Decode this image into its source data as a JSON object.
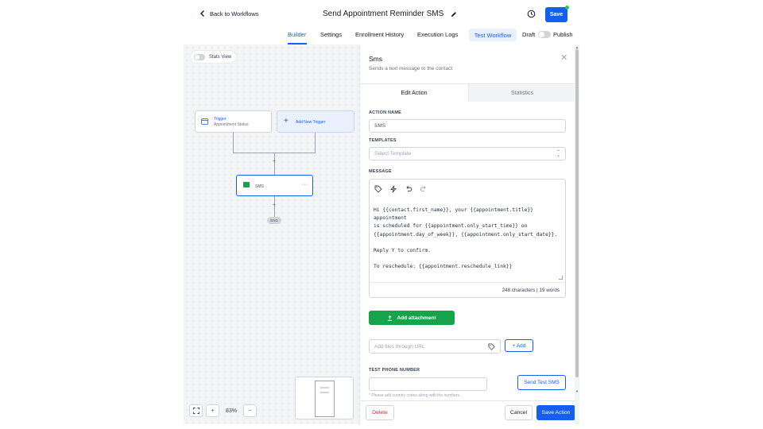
{
  "header": {
    "back_label": "Back to Workflows",
    "title": "Send Appointment Reminder SMS",
    "save_label": "Save"
  },
  "tabs": {
    "items": [
      {
        "label": "Builder",
        "active": true
      },
      {
        "label": "Settings"
      },
      {
        "label": "Enrollment History"
      },
      {
        "label": "Execution Logs"
      }
    ],
    "test_workflow": "Test Workflow",
    "draft": "Draft",
    "publish": "Publish"
  },
  "canvas": {
    "stats_view": "Stats View",
    "trigger_title": "Trigger",
    "trigger_sub": "Appointment Status",
    "add_trigger": "Add New Trigger",
    "sms_node": "SMS",
    "end": "END",
    "zoom": "83%"
  },
  "panel": {
    "title": "Sms",
    "subtitle": "Sends a text message to the contact",
    "tab_edit": "Edit Action",
    "tab_stats": "Statistics",
    "action_name_label": "ACTION NAME",
    "action_name_value": "SMS",
    "templates_label": "TEMPLATES",
    "templates_placeholder": "Select Template",
    "message_label": "MESSAGE",
    "message_text": "Hi {{contact.first_name}}, your {{appointment.title}} appointment\nis scheduled for {{appointment.only_start_time}} on\n{{appointment.day_of_week}}, {{appointment.only_start_date}}.\n\nReply Y to confirm.\n\nTo reschedule: {{appointment.reschedule_link}}",
    "counter": "248 characters | 19 words",
    "add_attachment": "Add attachment",
    "url_placeholder": "Add files through URL",
    "add_url": "+ Add",
    "test_phone_label": "TEST PHONE NUMBER",
    "send_test": "Send Test SMS",
    "hint": "* Please add country codes along with the numbers.",
    "delete": "Delete",
    "cancel": "Cancel",
    "save_action": "Save Action"
  },
  "colors": {
    "primary": "#155eef",
    "success": "#16a34a",
    "danger": "#dc2626"
  }
}
